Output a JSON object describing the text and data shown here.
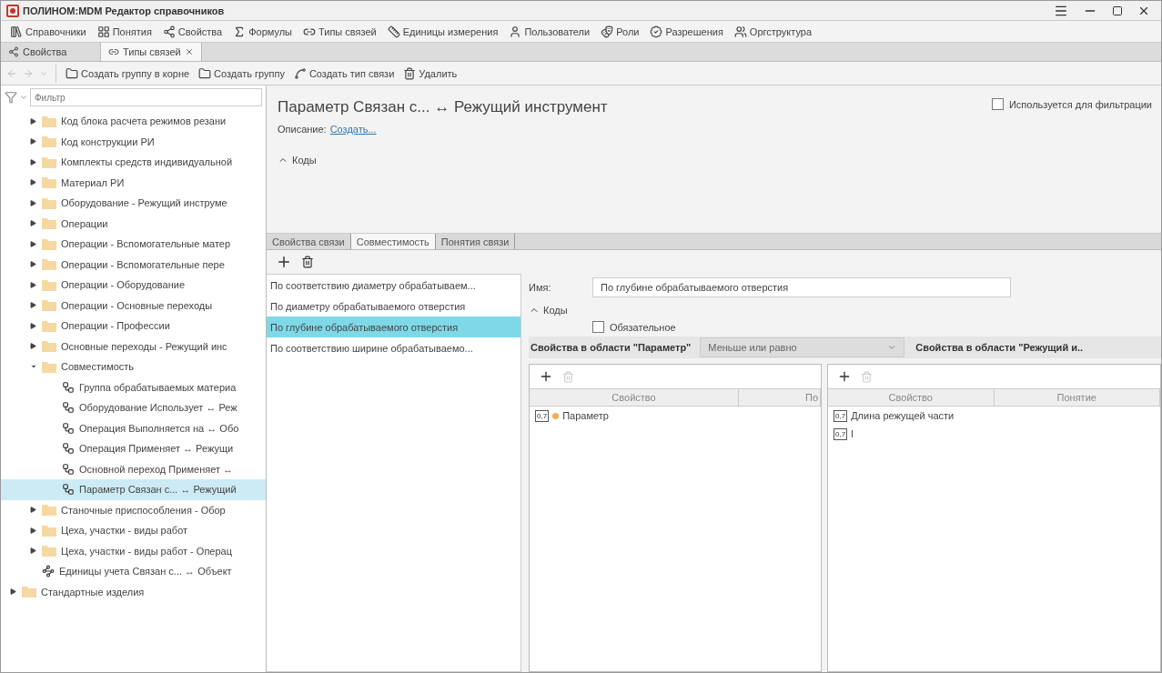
{
  "window": {
    "title": "ПОЛИНОМ:MDM Редактор справочников"
  },
  "menu": [
    "Справочники",
    "Понятия",
    "Свойства",
    "Формулы",
    "Типы связей",
    "Единицы измерения",
    "Пользователи",
    "Роли",
    "Разрешения",
    "Оргструктура"
  ],
  "doc_tabs": [
    {
      "label": "Свойства",
      "selected": false,
      "closable": false
    },
    {
      "label": "Типы связей",
      "selected": true,
      "closable": true
    }
  ],
  "toolbar": {
    "buttons": [
      "Создать группу в корне",
      "Создать группу",
      "Создать тип связи",
      "Удалить"
    ]
  },
  "filter": {
    "placeholder": "Фильтр"
  },
  "tree": [
    {
      "children": [
        {
          "kind": "folder",
          "label": "Код блока расчета режимов резани",
          "expanded": false,
          "selected": false
        },
        {
          "kind": "folder",
          "label": "Код конструкции РИ",
          "expanded": false,
          "selected": false
        },
        {
          "kind": "folder",
          "label": "Комплекты средств индивидуальной",
          "expanded": false,
          "selected": false
        },
        {
          "kind": "folder",
          "label": "Материал РИ",
          "expanded": false,
          "selected": false
        },
        {
          "kind": "folder",
          "label": "Оборудование - Режущий инструме",
          "expanded": false,
          "selected": false
        },
        {
          "kind": "folder",
          "label": "Операции",
          "expanded": false,
          "selected": false
        },
        {
          "kind": "folder",
          "label": "Операции - Вспомогательные матер",
          "expanded": false,
          "selected": false
        },
        {
          "kind": "folder",
          "label": "Операции - Вспомогательные пере",
          "expanded": false,
          "selected": false
        },
        {
          "kind": "folder",
          "label": "Операции - Оборудование",
          "expanded": false,
          "selected": false
        },
        {
          "kind": "folder",
          "label": "Операции - Основные переходы",
          "expanded": false,
          "selected": false
        },
        {
          "kind": "folder",
          "label": "Операции - Профессии",
          "expanded": false,
          "selected": false
        },
        {
          "kind": "folder",
          "label": "Основные переходы - Режущий инс",
          "expanded": false,
          "selected": false
        },
        {
          "kind": "folder",
          "label": "Совместимость",
          "expanded": true,
          "selected": false,
          "children": [
            {
              "kind": "compat",
              "label": "Группа обрабатываемых материа",
              "selected": false
            },
            {
              "kind": "compat",
              "label": "Оборудование Использует ↔ Реж",
              "selected": false
            },
            {
              "kind": "compat",
              "label": "Операция Выполняется на ↔ Обо",
              "selected": false
            },
            {
              "kind": "compat",
              "label": "Операция Применяет ↔ Режущи",
              "selected": false
            },
            {
              "kind": "compat",
              "label": "Основной переход Применяет ↔",
              "selected": false
            },
            {
              "kind": "compat",
              "label": "Параметр Связан с... ↔ Режущий",
              "selected": true
            }
          ]
        },
        {
          "kind": "folder",
          "label": "Станочные приспособления - Обор",
          "expanded": false,
          "selected": false
        },
        {
          "kind": "folder",
          "label": "Цеха, участки - виды работ",
          "expanded": false,
          "selected": false
        },
        {
          "kind": "folder",
          "label": "Цеха, участки - виды работ - Операц",
          "expanded": false,
          "selected": false
        },
        {
          "kind": "link",
          "label": "Единицы учета Связан с... ↔ Объект",
          "selected": false
        }
      ]
    },
    {
      "kind": "folder",
      "label": "Стандартные изделия",
      "expanded": false,
      "selected": false
    }
  ],
  "detail": {
    "title": "Параметр Связан с... ↔ Режущий инструмент",
    "filter_option": {
      "label": "Используется для фильтрации",
      "checked": false
    },
    "description_label": "Описание:",
    "description_link": "Создать...",
    "codes_label": "Коды"
  },
  "tabs": [
    {
      "label": "Свойства связи",
      "selected": false
    },
    {
      "label": "Совместимость",
      "selected": true
    },
    {
      "label": "Понятия связи",
      "selected": false
    }
  ],
  "variants": [
    {
      "label": "По соответствию диаметру обрабатываем...",
      "selected": false
    },
    {
      "label": "По диаметру обрабатываемого отверстия",
      "selected": false
    },
    {
      "label": "По глубине обрабатываемого отверстия",
      "selected": true
    },
    {
      "label": "По соответствию ширине обрабатываемо...",
      "selected": false
    }
  ],
  "editor": {
    "name_label": "Имя:",
    "name_value": "По глубине обрабатываемого отверстия",
    "codes_label": "Коды",
    "required": {
      "label": "Обязательное",
      "checked": false
    },
    "left_header": "Свойства в области \"Параметр\"",
    "operator": "Меньше или равно",
    "right_header": "Свойства в области \"Режущий и.."
  },
  "left_table": {
    "columns": [
      "Свойство",
      "По"
    ],
    "rows": [
      {
        "badge": "0,7",
        "dot": true,
        "name": "Параметр"
      }
    ]
  },
  "right_table": {
    "columns": [
      "Свойство",
      "Понятие"
    ],
    "rows": [
      {
        "badge": "0,7",
        "dot": false,
        "name": "Длина режущей части"
      },
      {
        "badge": "0,7",
        "dot": false,
        "name": "l"
      }
    ]
  }
}
